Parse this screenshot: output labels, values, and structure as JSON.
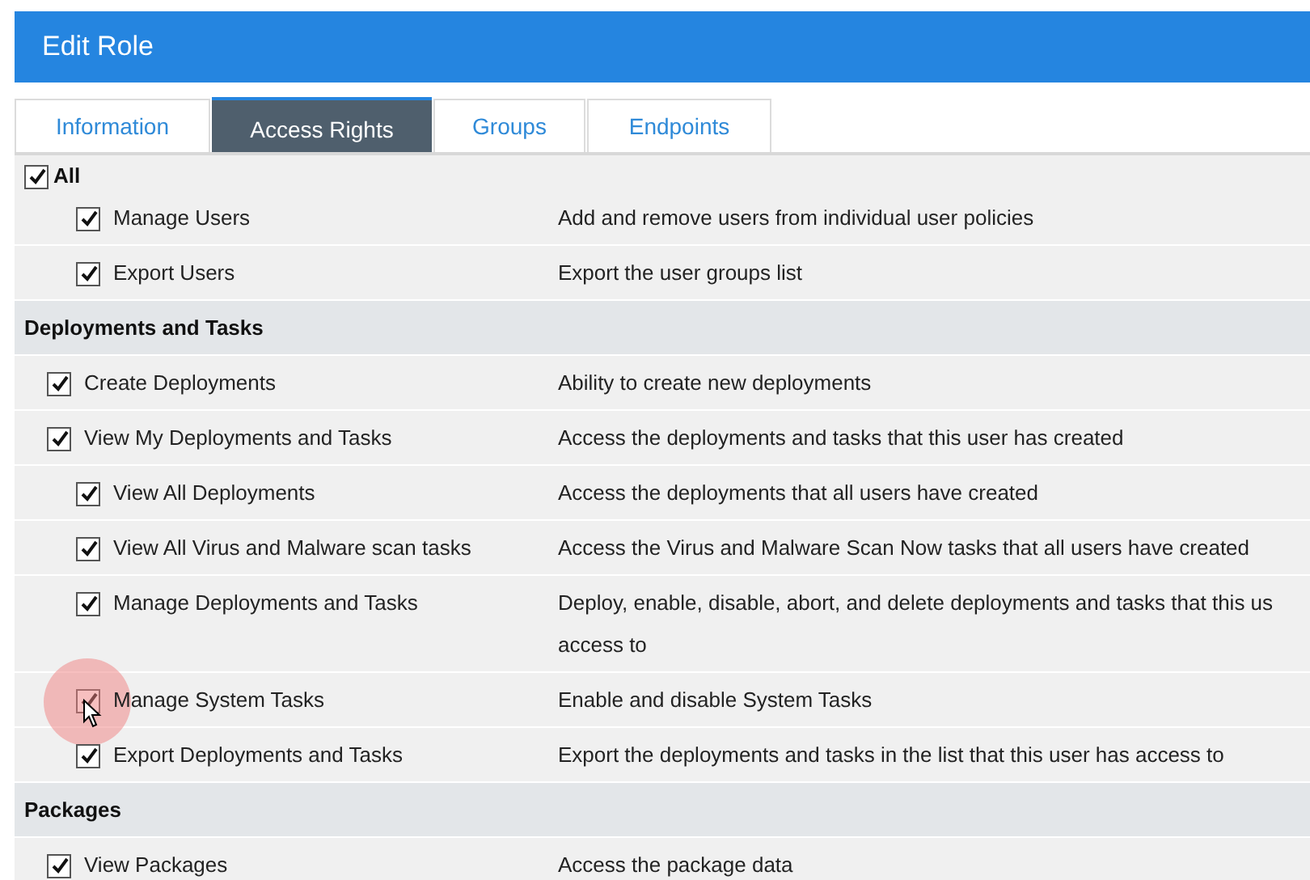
{
  "window": {
    "title": "Edit Role"
  },
  "tabs": [
    {
      "label": "Information",
      "selected": false
    },
    {
      "label": "Access Rights",
      "selected": true
    },
    {
      "label": "Groups",
      "selected": false
    },
    {
      "label": "Endpoints",
      "selected": false
    }
  ],
  "groups": [
    {
      "kind": "check-header",
      "label": "All",
      "checked": true,
      "rows": [
        {
          "label": "Manage Users",
          "checked": true,
          "description": "Add and remove users from individual user policies"
        },
        {
          "label": "Export Users",
          "checked": true,
          "description": "Export the user groups list"
        }
      ]
    },
    {
      "kind": "section",
      "label": "Deployments and Tasks",
      "rows": [
        {
          "label": "Create Deployments",
          "checked": true,
          "description": "Ability to create new deployments"
        },
        {
          "label": "View My Deployments and Tasks",
          "checked": true,
          "description": "Access the deployments and tasks that this user has created",
          "children": [
            {
              "label": "View All Deployments",
              "checked": true,
              "description": "Access the deployments that all users have created"
            },
            {
              "label": "View All Virus and Malware scan tasks",
              "checked": true,
              "description": "Access the Virus and Malware Scan Now tasks that all users have created"
            },
            {
              "label": "Manage Deployments and Tasks",
              "checked": true,
              "description": "Deploy, enable, disable, abort, and delete deployments and tasks that this us",
              "description_continued": "access to"
            },
            {
              "label": "Manage System Tasks",
              "checked": true,
              "description": "Enable and disable System Tasks",
              "pointer": true
            },
            {
              "label": "Export Deployments and Tasks",
              "checked": true,
              "description": "Export the deployments and tasks in the list that this user has access to"
            }
          ]
        }
      ]
    },
    {
      "kind": "section",
      "label": "Packages",
      "rows": [
        {
          "label": "View Packages",
          "checked": true,
          "description": "Access the package data"
        }
      ]
    }
  ]
}
